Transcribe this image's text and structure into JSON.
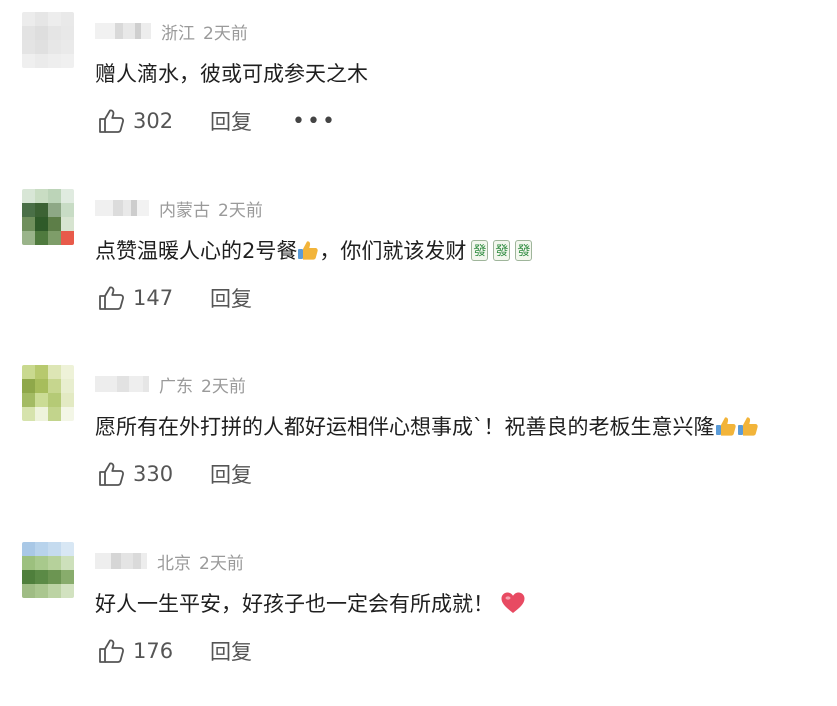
{
  "comments": [
    {
      "location": "浙江",
      "time": "2天前",
      "text": "赠人滴水，彼或可成参天之木",
      "likes": "302",
      "reply_label": "回复",
      "more_label": "•••",
      "avatar_colors": [
        "#ececec",
        "#e6e6e6",
        "#ededed",
        "#e9e9e9",
        "#e3e3e3",
        "#dedede",
        "#e5e5e5",
        "#e8e8e8",
        "#e4e4e4",
        "#e0e0e0",
        "#e7e7e7",
        "#eaeaea",
        "#efefef",
        "#ebebeb",
        "#eeeeee",
        "#f0f0f0"
      ]
    },
    {
      "location": "内蒙古",
      "time": "2天前",
      "text": "点赞温暖人心的2号餐",
      "text_tail": "，你们就该发财",
      "fa_tile_char": "發",
      "likes": "147",
      "reply_label": "回复",
      "avatar_colors": [
        "#d8e6d6",
        "#c9ddc3",
        "#bcd4b8",
        "#e0ebe0",
        "#4a6f47",
        "#3c6234",
        "#8ea886",
        "#c8dcc5",
        "#6f8f5c",
        "#2f5a29",
        "#5d7e48",
        "#d7e4d0",
        "#9ab48a",
        "#4f7a3e",
        "#7e9d69",
        "#e85a4a"
      ]
    },
    {
      "location": "广东",
      "time": "2天前",
      "text": "愿所有在外打拼的人都好运相伴心想事成`！祝善良的老板生意兴隆",
      "likes": "330",
      "reply_label": "回复",
      "avatar_colors": [
        "#c9d98f",
        "#b7c96e",
        "#dde6b5",
        "#eef2d8",
        "#8fa84a",
        "#a7bd5c",
        "#c6d68e",
        "#e8eecf",
        "#a3bb63",
        "#cbdc95",
        "#b5ca76",
        "#e3eac3",
        "#d6e3ad",
        "#eef3dc",
        "#c2d48c",
        "#f3f6e6"
      ]
    },
    {
      "location": "北京",
      "time": "2天前",
      "text": "好人一生平安，好孩子也一定会有所成就！",
      "likes": "176",
      "reply_label": "回复",
      "avatar_colors": [
        "#a9c8e6",
        "#b8d3ec",
        "#c5dbef",
        "#d8e7f4",
        "#9cc07e",
        "#a8c98c",
        "#b6d19b",
        "#cde0bb",
        "#4f7f3c",
        "#5b8a46",
        "#6c9552",
        "#88ac6c",
        "#9fbc84",
        "#aac68f",
        "#bcd3a4",
        "#d2e2c0"
      ]
    }
  ],
  "colors": {
    "meta": "#9a9a9a",
    "text": "#1f1f1f",
    "action": "#555555",
    "heart": "#e84a62",
    "thumb_emoji": "#f2b43a"
  }
}
